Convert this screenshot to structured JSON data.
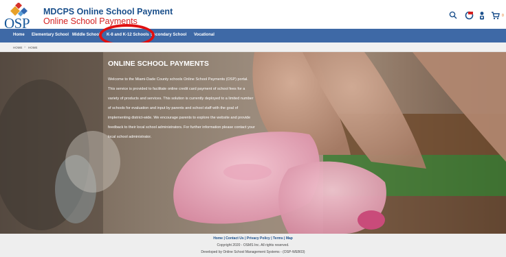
{
  "header": {
    "logo_text": "OSP",
    "title_line1": "MDCPS Online School Payment",
    "title_line2": "Online School Payments",
    "cart_count": "0"
  },
  "nav": {
    "items": [
      {
        "label": "Home"
      },
      {
        "label": "Elementary School"
      },
      {
        "label": "Middle School"
      },
      {
        "label": "K-8 and K-12 Schools"
      },
      {
        "label": "Secondary School"
      },
      {
        "label": "Vocational"
      }
    ]
  },
  "breadcrumb": {
    "items": [
      {
        "label": "HOME"
      },
      {
        "label": "HOME"
      }
    ],
    "separator": "»"
  },
  "hero": {
    "title": "ONLINE SCHOOL PAYMENTS",
    "body": "Welcome to the Miami-Dade County schools Online School Payments (OSP) portal. This service is provided to facilitate online credit card payment of school fees for a variety of products and services. This solution is currently deployed to a limited number of schools for evaluation and input by parents and school staff with the goal of implementing district-wide. We encourage parents to explore the website and provide feedback to their local school administrators. For further information please contact your local school administrator."
  },
  "footer": {
    "links": [
      {
        "label": "Home"
      },
      {
        "label": "Contact Us"
      },
      {
        "label": "Privacy Policy"
      },
      {
        "label": "Terms"
      },
      {
        "label": "Map"
      }
    ],
    "copyright": "Copyright 2020 - OSMS Inc. All rights reserved.",
    "developed_by": "Developed by Online School Management Systems - (OSP-WEB03)"
  },
  "colors": {
    "nav_bg": "#3e69a6",
    "title_blue": "#1a4f8b",
    "title_red": "#d42020",
    "highlight_circle": "#e01010"
  }
}
